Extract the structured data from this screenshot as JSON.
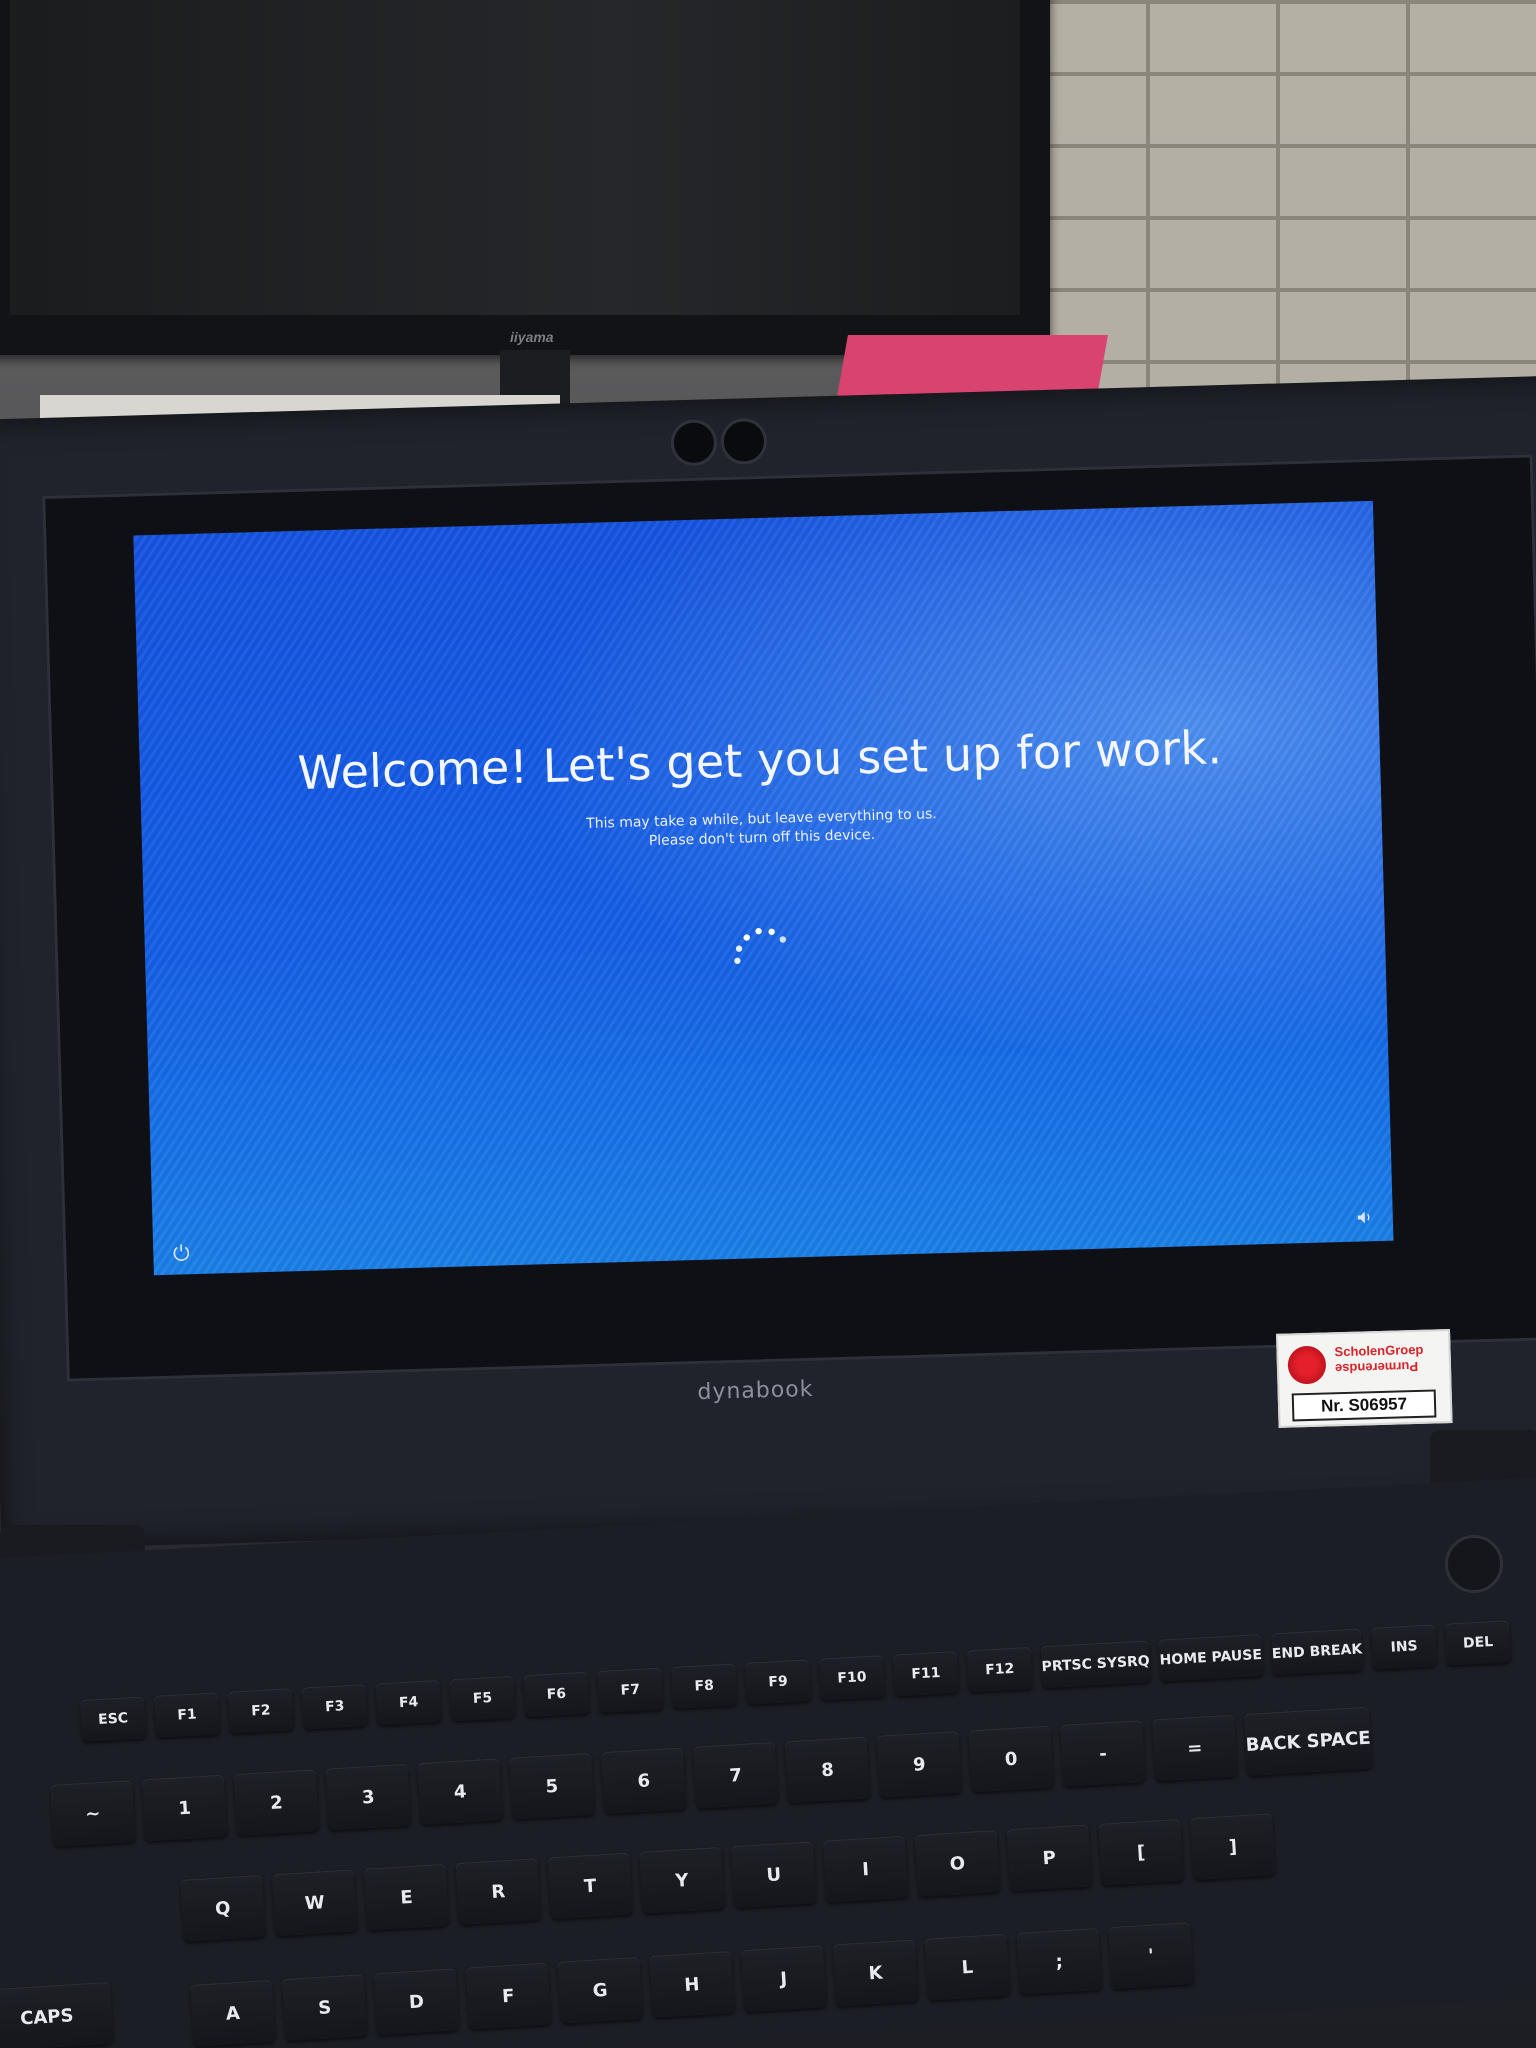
{
  "background": {
    "monitor_brand": "iiyama"
  },
  "setup_screen": {
    "title": "Welcome! Let's get you set up for work.",
    "subtitle_line1": "This may take a while, but leave everything to us.",
    "subtitle_line2": "Please don't turn off this device.",
    "spinner": "loading-spinner",
    "left_icon": "power-icon",
    "right_icon": "volume-icon",
    "colors": {
      "background_blue": "#1559e3",
      "text": "#f3f6ff"
    }
  },
  "laptop": {
    "brand": "dynabook",
    "sticker": {
      "org_line1": "ScholenGroep",
      "org_line2": "Purmerendse",
      "asset_number": "Nr. S06957"
    }
  },
  "keyboard": {
    "function_row": [
      "ESC",
      "F1",
      "F2",
      "F3",
      "F4",
      "F5",
      "F6",
      "F7",
      "F8",
      "F9",
      "F10",
      "F11",
      "F12",
      "PRTSC SYSRQ",
      "HOME PAUSE",
      "END BREAK",
      "INS",
      "DEL"
    ],
    "number_row": [
      "~",
      "1",
      "2",
      "3",
      "4",
      "5",
      "6",
      "7",
      "8",
      "9",
      "0",
      "-",
      "=",
      "BACK SPACE"
    ],
    "top_row": [
      "Q",
      "W",
      "E",
      "R",
      "T",
      "Y",
      "U",
      "I",
      "O",
      "P",
      "[",
      "]"
    ],
    "home_row": [
      "A",
      "S",
      "D",
      "F",
      "G",
      "H",
      "J",
      "K",
      "L",
      ";",
      "'"
    ],
    "caps_label": "CAPS"
  }
}
